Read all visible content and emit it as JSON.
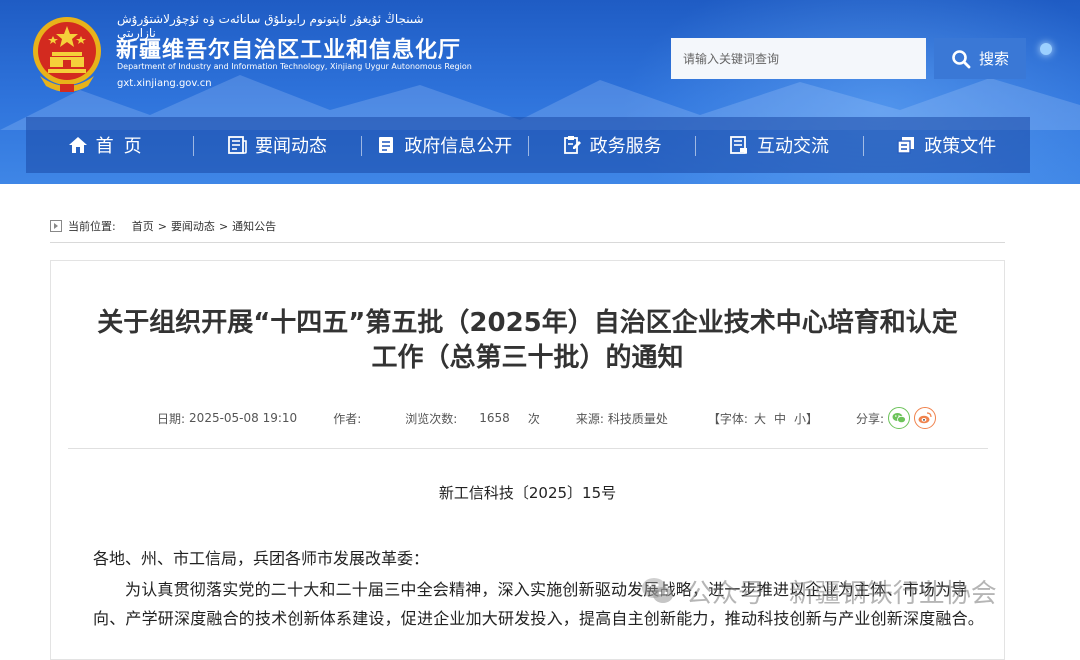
{
  "header": {
    "uyghur_name": "شىنجاڭ ئۇيغۇر ئاپتونوم رايونلۇق سانائەت ۋە ئۇچۇرلاشتۇرۇش نازارىتى",
    "site_name": "新疆维吾尔自治区工业和信息化厅",
    "site_name_en": "Department of Industry and Information Technology, Xinjiang Uygur Autonomous Region",
    "site_url": "gxt.xinjiang.gov.cn",
    "search": {
      "placeholder": "请输入关键词查询",
      "button_label": "搜索"
    }
  },
  "nav": {
    "items": [
      {
        "label": "首页",
        "icon": "home-icon"
      },
      {
        "label": "要闻动态",
        "icon": "newspaper-icon"
      },
      {
        "label": "政府信息公开",
        "icon": "document-icon"
      },
      {
        "label": "政务服务",
        "icon": "service-icon"
      },
      {
        "label": "互动交流",
        "icon": "chat-icon"
      },
      {
        "label": "政策文件",
        "icon": "files-icon"
      }
    ]
  },
  "breadcrumb": {
    "current_label": "当前位置:",
    "items": [
      "首页",
      "要闻动态",
      "通知公告"
    ],
    "separator": ">"
  },
  "article": {
    "title_line1": "关于组织开展“十四五”第五批（2025年）自治区企业技术中心培育和认定",
    "title_line2": "工作（总第三十批）的通知",
    "meta": {
      "date_label": "日期:",
      "date": "2025-05-08 19:10",
      "author_label": "作者:",
      "views_label": "浏览次数:",
      "views": "1658",
      "views_unit": "次",
      "source_label": "来源:",
      "source": "科技质量处",
      "font_label": "【字体:",
      "font_large": "大",
      "font_medium": "中",
      "font_small": "小】",
      "share_label": "分享:"
    },
    "doc_number": "新工信科技〔2025〕15号",
    "addressee": "各地、州、市工信局，兵团各师市发展改革委：",
    "paragraph": "为认真贯彻落实党的二十大和二十届三中全会精神，深入实施创新驱动发展战略，进一步推进以企业为主体、市场为导向、产学研深度融合的技术创新体系建设，促进企业加大研发投入，提高自主创新能力，推动科技创新与产业创新深度融合。"
  },
  "watermark": {
    "text": "公众号 · 新疆钢铁行业协会"
  },
  "colors": {
    "header_blue": "#2f74dc",
    "nav_bg": "#1a48a5",
    "wechat_green": "#6cc35a",
    "weibo_orange": "#f0824c"
  }
}
